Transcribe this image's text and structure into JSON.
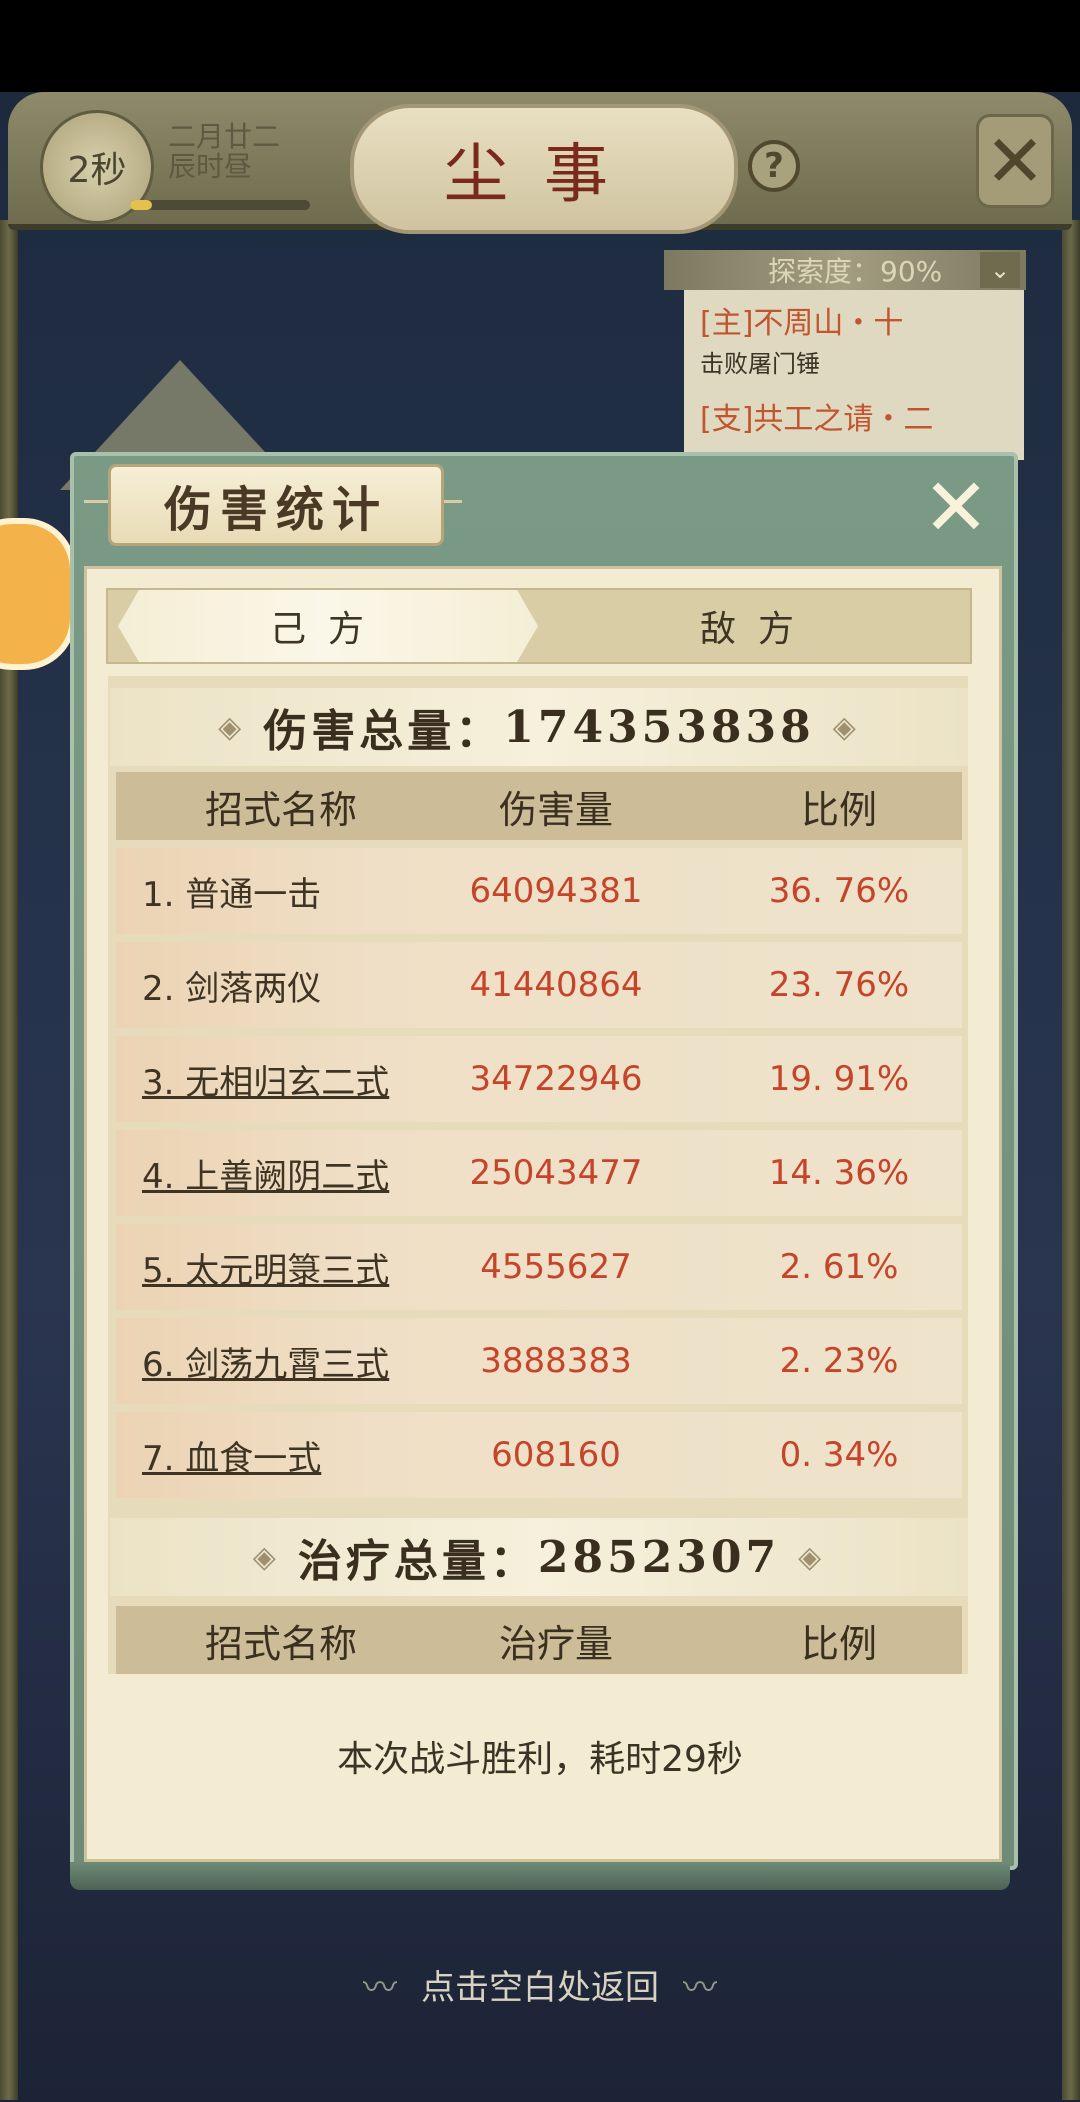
{
  "topbar": {
    "timer": "2秒",
    "date_line1": "二月廿二",
    "date_line2": "辰时昼",
    "title": "尘事",
    "help": "?",
    "close": "✕"
  },
  "quest": {
    "exploration": "探索度：90%",
    "main_quest": "[主]不周山・十",
    "main_quest_desc": "击败屠门锤",
    "side_quest": "[支]共工之请・二"
  },
  "dialog": {
    "title": "伤害统计",
    "close": "✕",
    "tabs": [
      {
        "label": "己方",
        "active": true
      },
      {
        "label": "敌方",
        "active": false
      }
    ],
    "damage": {
      "header_label": "伤害总量：",
      "total": "174353838",
      "columns": [
        "招式名称",
        "伤害量",
        "比例"
      ],
      "rows": [
        {
          "name": "1. 普通一击",
          "amount": "64094381",
          "pct": "36. 76%",
          "link": false
        },
        {
          "name": "2. 剑落两仪",
          "amount": "41440864",
          "pct": "23. 76%",
          "link": false
        },
        {
          "name": "3. 无相归玄二式",
          "amount": "34722946",
          "pct": "19. 91%",
          "link": true
        },
        {
          "name": "4. 上善阙阴二式",
          "amount": "25043477",
          "pct": "14. 36%",
          "link": true
        },
        {
          "name": "5. 太元明箓三式",
          "amount": "4555627",
          "pct": "2. 61%",
          "link": true
        },
        {
          "name": "6. 剑荡九霄三式",
          "amount": "3888383",
          "pct": "2. 23%",
          "link": true
        },
        {
          "name": "7. 血食一式",
          "amount": "608160",
          "pct": "0. 34%",
          "link": true
        }
      ]
    },
    "healing": {
      "header_label": "治疗总量：",
      "total": "2852307",
      "columns": [
        "招式名称",
        "治疗量",
        "比例"
      ]
    },
    "footer": "本次战斗胜利，耗时29秒"
  },
  "return_hint": "点击空白处返回",
  "colors": {
    "accent_red": "#c5452b",
    "panel_bg": "#f3ecd3",
    "dialog_frame": "#7b9a86"
  }
}
